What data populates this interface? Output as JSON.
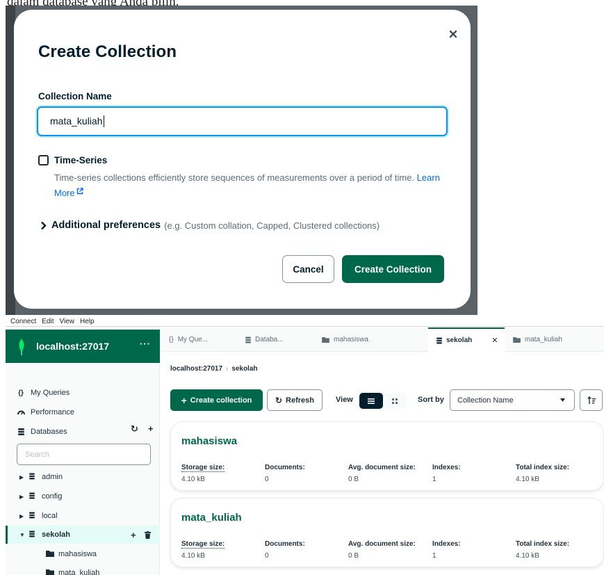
{
  "top_text": "dalam database yang Anda pilih.",
  "modal": {
    "title": "Create Collection",
    "name_label": "Collection Name",
    "name_value": "mata_kuliah",
    "timeseries_label": "Time-Series",
    "timeseries_desc": "Time-series collections efficiently store sequences of measurements over a period of time.",
    "learn_more": "Learn More",
    "additional_label": "Additional preferences",
    "additional_hint": "(e.g. Custom collation, Capped, Clustered collections)",
    "cancel_label": "Cancel",
    "create_label": "Create Collection"
  },
  "menubar": [
    "Connect",
    "Edit",
    "View",
    "Help"
  ],
  "sidebar": {
    "connection": "localhost:27017",
    "more": "···",
    "nav": [
      "My Queries",
      "Performance",
      "Databases"
    ],
    "search_placeholder": "Search",
    "databases": [
      "admin",
      "config",
      "local",
      "sekolah"
    ],
    "collections": [
      "mahasiswa",
      "mata_kuliah"
    ]
  },
  "tabs": [
    "My Que...",
    "Databa...",
    "mahasiswa",
    "sekolah",
    "mata_kuliah"
  ],
  "breadcrumb": {
    "host": "localhost:27017",
    "db": "sekolah"
  },
  "toolbar": {
    "create": "Create collection",
    "refresh": "Refresh",
    "view": "View",
    "sortby": "Sort by",
    "sort_value": "Collection Name"
  },
  "stat_labels": [
    "Storage size:",
    "Documents:",
    "Avg. document size:",
    "Indexes:",
    "Total index size:"
  ],
  "cards": [
    {
      "name": "mahasiswa",
      "storage": "4.10 kB",
      "documents": "0",
      "avg": "0 B",
      "indexes": "1",
      "total_index": "4.10 kB"
    },
    {
      "name": "mata_kuliah",
      "storage": "4.10 kB",
      "documents": "0",
      "avg": "0 B",
      "indexes": "1",
      "total_index": "4.10 kB"
    }
  ],
  "colors": {
    "brand_green": "#00684a",
    "focus_blue": "#0498ec",
    "link_blue": "#016bf8"
  }
}
